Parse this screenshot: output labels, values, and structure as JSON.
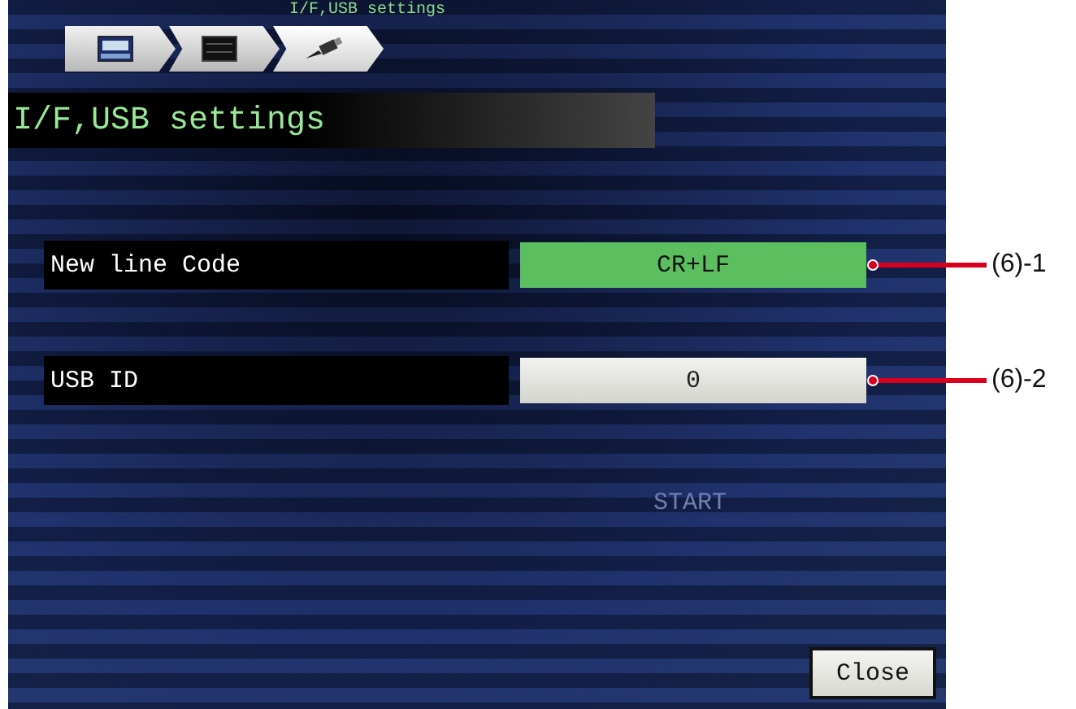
{
  "breadcrumb": {
    "current_label": "I/F,USB settings",
    "steps": [
      {
        "kind": "recorder",
        "selected": false
      },
      {
        "kind": "display",
        "selected": false
      },
      {
        "kind": "usb",
        "selected": true
      }
    ]
  },
  "title": "I/F,USB settings",
  "settings": [
    {
      "label": "New line Code",
      "value": "CR+LF",
      "selected": true,
      "callout": "(6)-1"
    },
    {
      "label": "USB ID",
      "value": "0",
      "selected": false,
      "callout": "(6)-2"
    }
  ],
  "background_text": "START",
  "buttons": [
    "Close"
  ]
}
